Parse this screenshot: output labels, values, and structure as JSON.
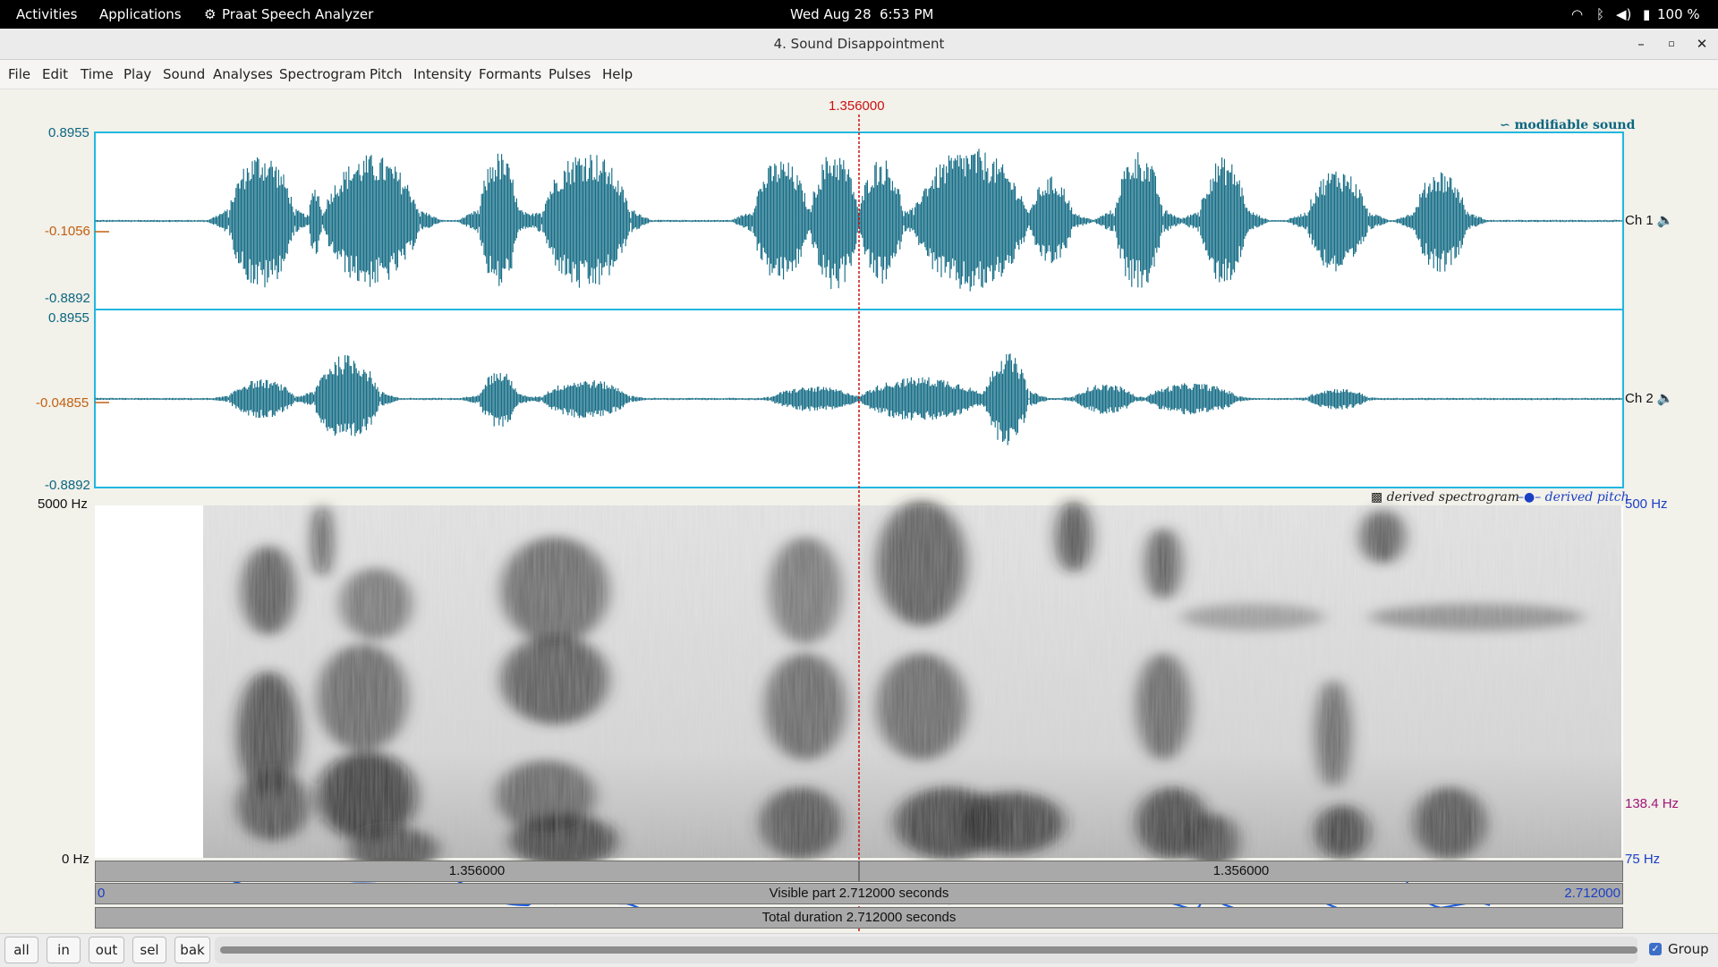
{
  "topbar": {
    "activities": "Activities",
    "applications": "Applications",
    "app_name": "Praat Speech Analyzer",
    "date": "Wed Aug 28",
    "time": "6:53 PM",
    "battery": "100 %"
  },
  "window": {
    "title": "4. Sound Disappointment"
  },
  "menu": [
    "File",
    "Edit",
    "Time",
    "Play",
    "Sound",
    "Analyses",
    "Spectrogram",
    "Pitch",
    "Intensity",
    "Formants",
    "Pulses",
    "Help"
  ],
  "cursor_time": "1.356000",
  "ch1": {
    "top": "0.8955",
    "mid": "-0.1056",
    "bottom": "-0.8892",
    "label": "Ch 1"
  },
  "ch2": {
    "top": "0.8955",
    "mid": "-0.04855",
    "bottom": "-0.8892",
    "label": "Ch 2"
  },
  "legend": {
    "modifiable": "modifiable sound",
    "spectrogram": "derived spectrogram",
    "pitch": "derived pitch"
  },
  "spectro": {
    "freq_top": "5000 Hz",
    "freq_bottom": "0 Hz",
    "pitch_top": "500 Hz",
    "pitch_value": "138.4 Hz",
    "pitch_bottom": "75 Hz"
  },
  "timebars": {
    "left_segment": "1.356000",
    "right_segment": "1.356000",
    "visible": "Visible part 2.712000 seconds",
    "visible_start": "0",
    "visible_end": "2.712000",
    "total": "Total duration 2.712000 seconds"
  },
  "buttons": {
    "all": "all",
    "in": "in",
    "out": "out",
    "sel": "sel",
    "bak": "bak",
    "group": "Group"
  },
  "colors": {
    "wave": "#0b6680",
    "pitch": "#1b5ee0",
    "cursor": "#cc1111",
    "frame": "#22b7e0",
    "axis_mid": "#c06010"
  }
}
